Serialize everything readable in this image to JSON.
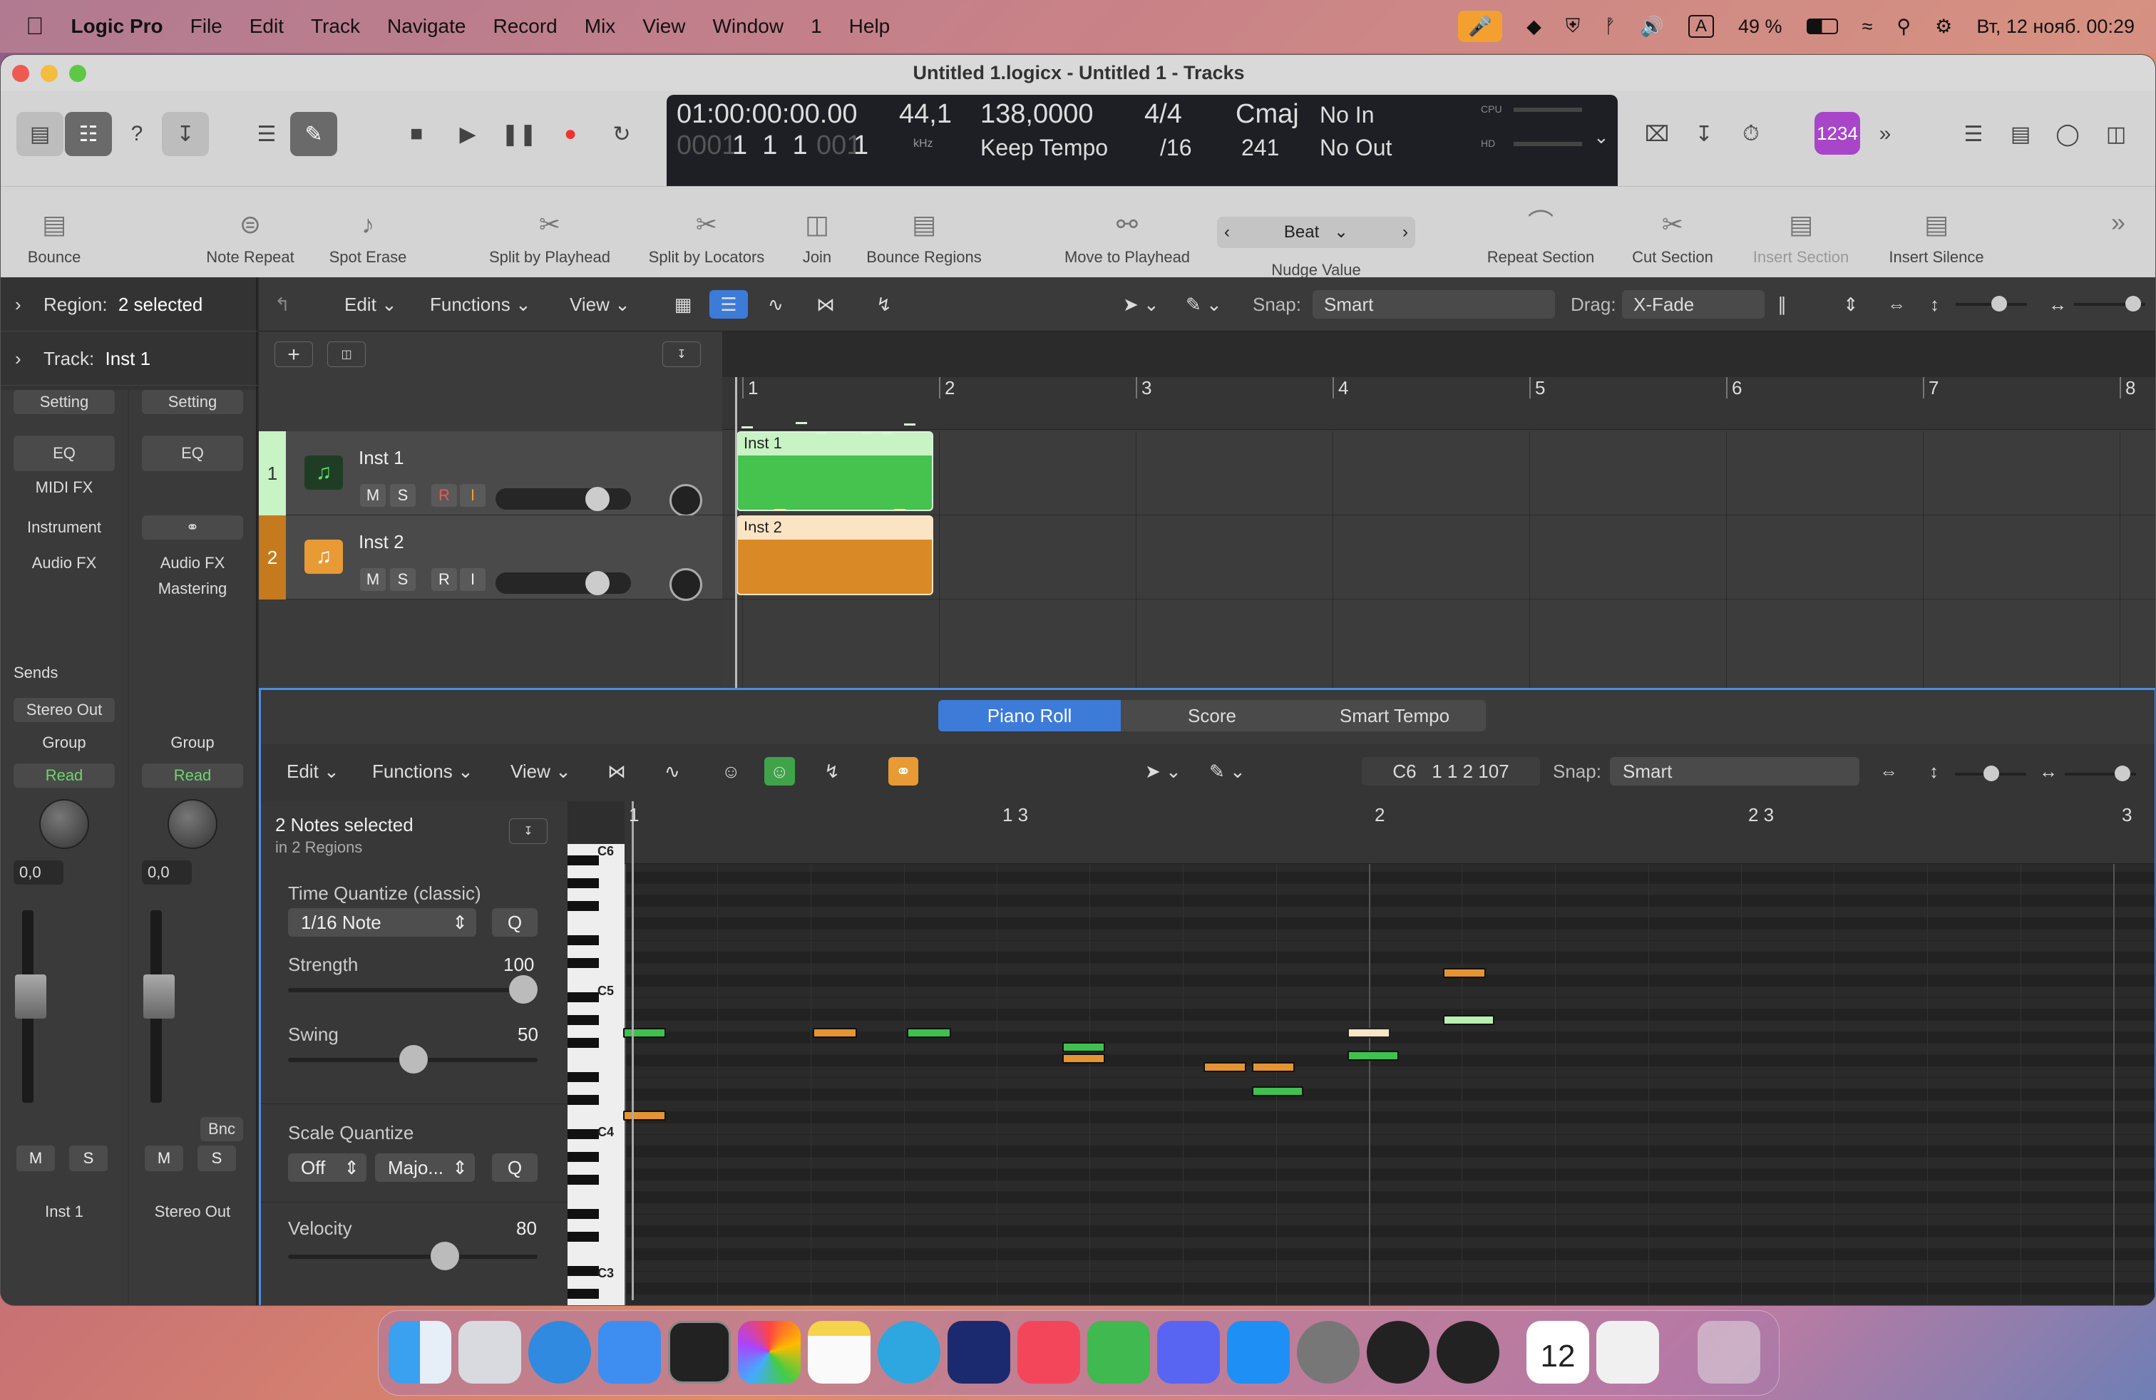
{
  "menubar": {
    "app": "Logic Pro",
    "items": [
      "File",
      "Edit",
      "Track",
      "Navigate",
      "Record",
      "Mix",
      "View",
      "Window",
      "1",
      "Help"
    ],
    "battery": "49 %",
    "datetime": "Вт, 12 нояб. 00:29",
    "input": "A"
  },
  "window": {
    "title": "Untitled 1.logicx - Untitled 1 - Tracks"
  },
  "lcd": {
    "time": "01:00:00:00.00",
    "bars_prefix": "0001",
    "bars": "1  1  1",
    "bars_suffix": "001",
    "bars_last": "1",
    "rate": "44,1",
    "rate_unit": "kHz",
    "tempo": "138,0000",
    "tempo_mode": "Keep Tempo",
    "sig": "4/4",
    "div": "/16",
    "key": "Cmaj",
    "key_num": "241",
    "in": "No In",
    "out": "No Out",
    "cpu": "CPU",
    "hd": "HD"
  },
  "badge": "1234",
  "toolbar2": {
    "bounce": "Bounce",
    "note_repeat": "Note Repeat",
    "spot_erase": "Spot Erase",
    "split_playhead": "Split by Playhead",
    "split_locators": "Split by Locators",
    "join": "Join",
    "bounce_regions": "Bounce Regions",
    "move_playhead": "Move to Playhead",
    "nudge": "Beat",
    "nudge_label": "Nudge Value",
    "repeat_section": "Repeat Section",
    "cut_section": "Cut Section",
    "insert_section": "Insert Section",
    "insert_silence": "Insert Silence"
  },
  "inspector": {
    "region_label": "Region:",
    "region_value": "2 selected",
    "track_label": "Track:",
    "track_value": "Inst 1"
  },
  "strip1": {
    "setting": "Setting",
    "eq": "EQ",
    "midifx": "MIDI FX",
    "instrument": "Instrument",
    "audiofx": "Audio FX",
    "sends": "Sends",
    "output": "Stereo Out",
    "group": "Group",
    "read": "Read",
    "value": "0,0",
    "m": "M",
    "s": "S",
    "name": "Inst 1"
  },
  "strip2": {
    "setting": "Setting",
    "eq": "EQ",
    "audiofx": "Audio FX",
    "mastering": "Mastering",
    "group": "Group",
    "read": "Read",
    "value": "0,0",
    "bnc": "Bnc",
    "m": "M",
    "s": "S",
    "name": "Stereo Out"
  },
  "tracksbar": {
    "edit": "Edit",
    "functions": "Functions",
    "view": "View",
    "snap_label": "Snap:",
    "snap": "Smart",
    "drag_label": "Drag:",
    "drag": "X-Fade"
  },
  "tracks": [
    {
      "num": "1",
      "name": "Inst 1",
      "m": "M",
      "s": "S",
      "r": "R",
      "i": "I"
    },
    {
      "num": "2",
      "name": "Inst 2",
      "m": "M",
      "s": "S",
      "r": "R",
      "i": "I"
    }
  ],
  "ruler": [
    "1",
    "2",
    "3",
    "4",
    "5",
    "6",
    "7",
    "8"
  ],
  "regions": [
    {
      "name": "Inst 1",
      "color": "#46c24f"
    },
    {
      "name": "Inst 2",
      "color": "#e0922f"
    }
  ],
  "editor": {
    "tabs": [
      "Piano Roll",
      "Score",
      "Smart Tempo"
    ],
    "edit": "Edit",
    "functions": "Functions",
    "view": "View",
    "position": "C6   1 1 2 107",
    "snap_label": "Snap:",
    "snap": "Smart",
    "status": "2 Notes selected",
    "status_sub": "in 2 Regions",
    "tq_label": "Time Quantize (classic)",
    "tq_value": "1/16 Note",
    "q": "Q",
    "strength_label": "Strength",
    "strength": "100",
    "swing_label": "Swing",
    "swing": "50",
    "sq_label": "Scale Quantize",
    "sq_off": "Off",
    "sq_scale": "Majo...",
    "velocity_label": "Velocity",
    "velocity": "80",
    "ruler": [
      "1",
      "1 3",
      "2",
      "2 3",
      "3"
    ],
    "keys": [
      "C6",
      "C5",
      "C4",
      "C3"
    ]
  }
}
